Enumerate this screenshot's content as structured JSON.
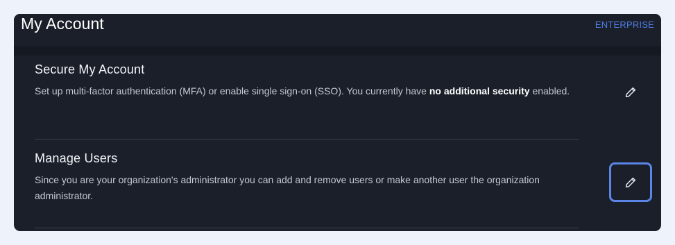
{
  "header": {
    "title": "My Account",
    "badge": "ENTERPRISE"
  },
  "sections": [
    {
      "title": "Secure My Account",
      "desc_prefix": "Set up multi-factor authentication (MFA) or enable single sign-on (SSO). You currently have ",
      "desc_bold": "no additional security",
      "desc_suffix": " enabled.",
      "action_icon": "pencil-icon"
    },
    {
      "title": "Manage Users",
      "desc": "Since you are your organization's administrator you can add and remove users or make another user the organization administrator.",
      "action_icon": "pencil-icon"
    }
  ],
  "colors": {
    "panel_bg": "#1b1f2a",
    "page_bg": "#edf2fb",
    "accent": "#4f7fe6",
    "focus_ring": "#5b86e8"
  }
}
